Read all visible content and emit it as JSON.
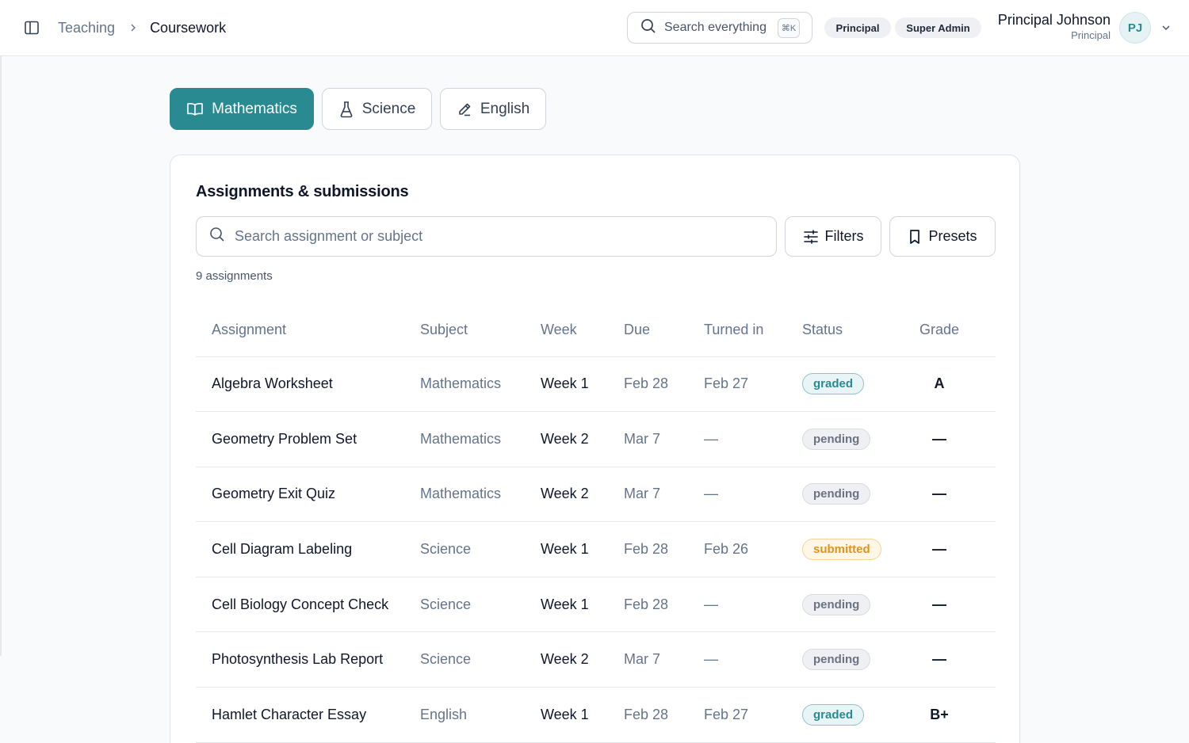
{
  "header": {
    "breadcrumb": {
      "parent": "Teaching",
      "current": "Coursework"
    },
    "search": {
      "label": "Search everything",
      "shortcut": "⌘K"
    },
    "roles": [
      "Principal",
      "Super Admin"
    ],
    "user": {
      "name": "Principal Johnson",
      "role": "Principal",
      "initials": "PJ"
    }
  },
  "tabs": [
    {
      "label": "Mathematics",
      "icon": "book-open-icon",
      "active": true
    },
    {
      "label": "Science",
      "icon": "flask-icon",
      "active": false
    },
    {
      "label": "English",
      "icon": "pencil-icon",
      "active": false
    }
  ],
  "card": {
    "title": "Assignments & submissions",
    "search_placeholder": "Search assignment or subject",
    "filters_label": "Filters",
    "presets_label": "Presets",
    "count_text": "9 assignments"
  },
  "table": {
    "columns": [
      "Assignment",
      "Subject",
      "Week",
      "Due",
      "Turned in",
      "Status",
      "Grade"
    ],
    "rows": [
      {
        "assignment": "Algebra Worksheet",
        "subject": "Mathematics",
        "week": "Week 1",
        "due": "Feb 28",
        "turned_in": "Feb 27",
        "status": "graded",
        "grade": "A"
      },
      {
        "assignment": "Geometry Problem Set",
        "subject": "Mathematics",
        "week": "Week 2",
        "due": "Mar 7",
        "turned_in": "—",
        "status": "pending",
        "grade": "—"
      },
      {
        "assignment": "Geometry Exit Quiz",
        "subject": "Mathematics",
        "week": "Week 2",
        "due": "Mar 7",
        "turned_in": "—",
        "status": "pending",
        "grade": "—"
      },
      {
        "assignment": "Cell Diagram Labeling",
        "subject": "Science",
        "week": "Week 1",
        "due": "Feb 28",
        "turned_in": "Feb 26",
        "status": "submitted",
        "grade": "—"
      },
      {
        "assignment": "Cell Biology Concept Check",
        "subject": "Science",
        "week": "Week 1",
        "due": "Feb 28",
        "turned_in": "—",
        "status": "pending",
        "grade": "—"
      },
      {
        "assignment": "Photosynthesis Lab Report",
        "subject": "Science",
        "week": "Week 2",
        "due": "Mar 7",
        "turned_in": "—",
        "status": "pending",
        "grade": "—"
      },
      {
        "assignment": "Hamlet Character Essay",
        "subject": "English",
        "week": "Week 1",
        "due": "Feb 28",
        "turned_in": "Feb 27",
        "status": "graded",
        "grade": "B+"
      }
    ]
  },
  "colors": {
    "accent": "#2a8a91",
    "warning": "#e19419",
    "muted": "#64748b"
  }
}
